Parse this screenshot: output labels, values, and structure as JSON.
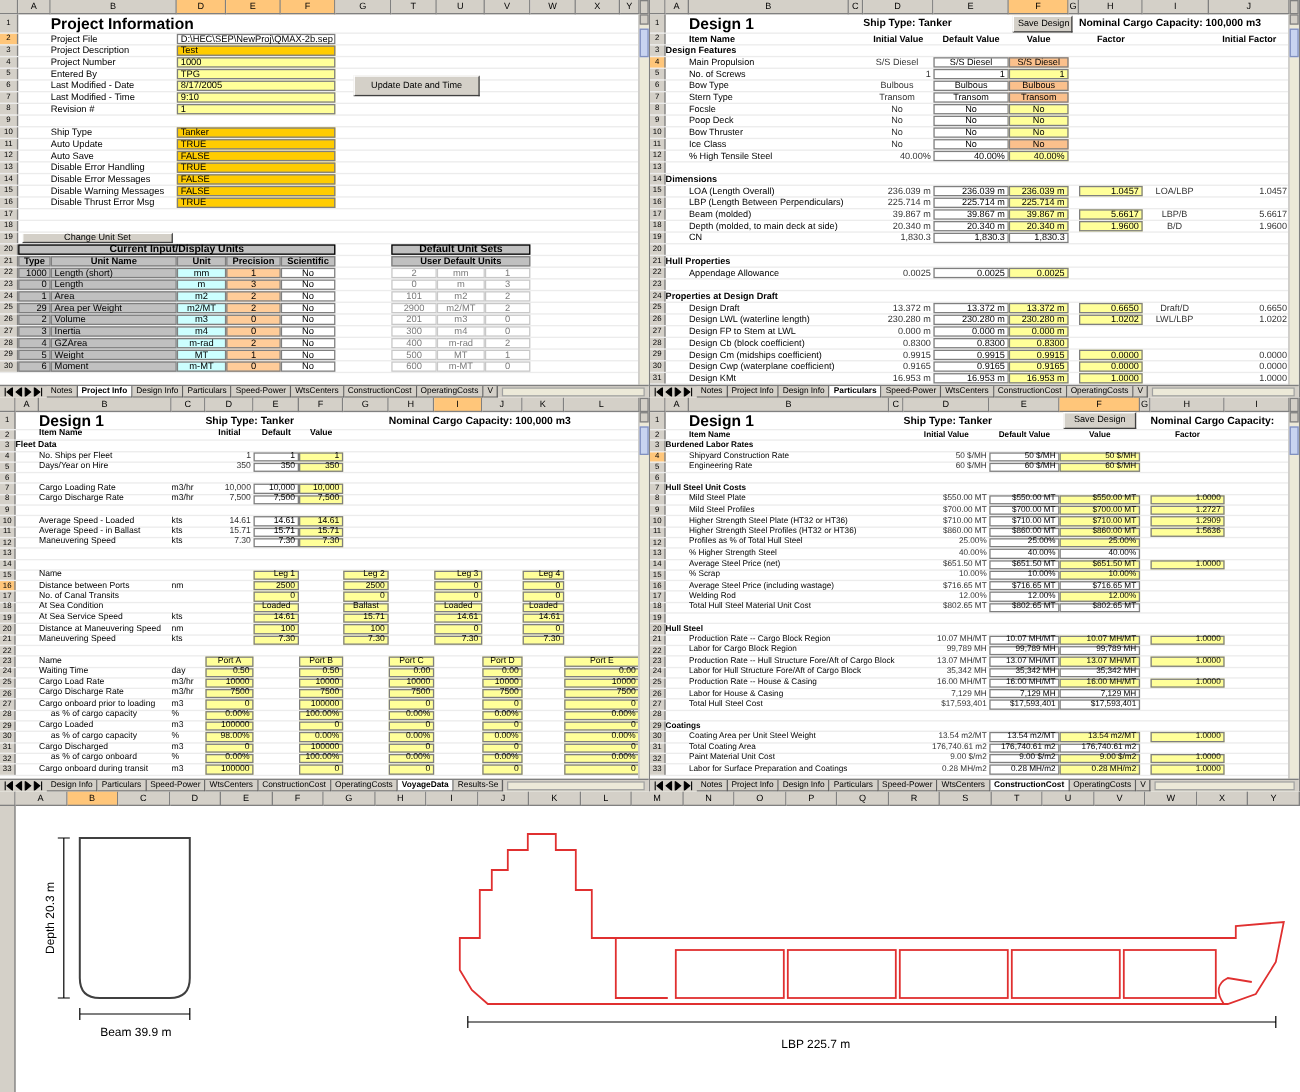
{
  "panes": [
    {
      "kind": "project-info",
      "columns": [
        {
          "label": "A",
          "selected": false
        },
        {
          "label": "B",
          "selected": false
        },
        {
          "label": "D",
          "selected": true
        },
        {
          "label": "E",
          "selected": true
        },
        {
          "label": "F",
          "selected": true
        },
        {
          "label": "G",
          "selected": false
        },
        {
          "label": "T",
          "selected": false
        },
        {
          "label": "U",
          "selected": false
        },
        {
          "label": "V",
          "selected": false
        },
        {
          "label": "W",
          "selected": false
        },
        {
          "label": "X",
          "selected": false
        },
        {
          "label": "Y",
          "selected": false
        }
      ],
      "rows": [
        {
          "number": "1",
          "selected": false,
          "kind": "title",
          "text": "Project Information"
        },
        {
          "number": "2",
          "selected": true,
          "kind": "path-field",
          "label": "Project File",
          "value": "D:\\HEC\\SEP\\NewProj\\QMAX-2b.sep"
        },
        {
          "number": "3",
          "selected": false,
          "kind": "choice-field",
          "label": "Project Description",
          "value": "Test"
        },
        {
          "number": "4",
          "selected": false,
          "kind": "entry-field",
          "label": "Project Number",
          "value": "1000"
        },
        {
          "number": "5",
          "selected": false,
          "kind": "entry-field",
          "label": "Entered By",
          "value": "TPG"
        },
        {
          "number": "6",
          "selected": false,
          "kind": "entry-field",
          "label": "Last Modified - Date",
          "value": "8/17/2005",
          "button": "Update Date and Time"
        },
        {
          "number": "7",
          "selected": false,
          "kind": "entry-field",
          "label": "Last Modified - Time",
          "value": "9:10"
        },
        {
          "number": "8",
          "selected": false,
          "kind": "entry-field",
          "label": "Revision #",
          "value": "1"
        },
        {
          "number": "9",
          "selected": false,
          "kind": "blank"
        },
        {
          "number": "10",
          "selected": false,
          "kind": "choice-field",
          "label": "Ship Type",
          "value": "Tanker"
        },
        {
          "number": "11",
          "selected": false,
          "kind": "choice-field",
          "label": "Auto Update",
          "value": "TRUE"
        },
        {
          "number": "12",
          "selected": false,
          "kind": "choice-field",
          "label": "Auto Save",
          "value": "FALSE"
        },
        {
          "number": "13",
          "selected": false,
          "kind": "choice-field",
          "label": "Disable Error Handling",
          "value": "TRUE"
        },
        {
          "number": "14",
          "selected": false,
          "kind": "choice-field",
          "label": "Disable Error Messages",
          "value": "FALSE"
        },
        {
          "number": "15",
          "selected": false,
          "kind": "choice-field",
          "label": "Disable Warning Messages",
          "value": "FALSE"
        },
        {
          "number": "16",
          "selected": false,
          "kind": "choice-field",
          "label": "Disable Thrust Error Msg",
          "value": "TRUE"
        },
        {
          "number": "17",
          "selected": false,
          "kind": "blank"
        },
        {
          "number": "18",
          "selected": false,
          "kind": "blank"
        },
        {
          "number": "19",
          "selected": false,
          "kind": "button",
          "text": "Change Unit Set"
        },
        {
          "number": "20",
          "selected": false,
          "kind": "table-titles",
          "left": "Current Input/Display Units",
          "right": "Default Unit Sets"
        },
        {
          "number": "21",
          "selected": false,
          "kind": "table-header",
          "headers": [
            "Type",
            "Unit Name",
            "Unit",
            "Precision",
            "Scientific"
          ],
          "right": "User Default Units"
        },
        {
          "number": "22",
          "selected": false,
          "kind": "unit",
          "type": "1000",
          "name": "Length (short)",
          "unit": "mm",
          "precision": "1",
          "scientific": "No",
          "defaults": [
            "2",
            "mm",
            "1"
          ]
        },
        {
          "number": "23",
          "selected": false,
          "kind": "unit",
          "type": "0",
          "name": "Length",
          "unit": "m",
          "precision": "3",
          "scientific": "No",
          "defaults": [
            "0",
            "m",
            "3"
          ]
        },
        {
          "number": "24",
          "selected": false,
          "kind": "unit",
          "type": "1",
          "name": "Area",
          "unit": "m2",
          "precision": "2",
          "scientific": "No",
          "defaults": [
            "101",
            "m2",
            "2"
          ]
        },
        {
          "number": "25",
          "selected": false,
          "kind": "unit",
          "type": "29",
          "name": "Area per Weight",
          "unit": "m2/MT",
          "precision": "2",
          "scientific": "No",
          "defaults": [
            "2900",
            "m2/MT",
            "2"
          ]
        },
        {
          "number": "26",
          "selected": false,
          "kind": "unit",
          "type": "2",
          "name": "Volume",
          "unit": "m3",
          "precision": "0",
          "scientific": "No",
          "defaults": [
            "201",
            "m3",
            "0"
          ]
        },
        {
          "number": "27",
          "selected": false,
          "kind": "unit",
          "type": "3",
          "name": "Inertia",
          "unit": "m4",
          "precision": "0",
          "scientific": "No",
          "defaults": [
            "300",
            "m4",
            "0"
          ]
        },
        {
          "number": "28",
          "selected": false,
          "kind": "unit",
          "type": "4",
          "name": "GZArea",
          "unit": "m-rad",
          "precision": "2",
          "scientific": "No",
          "defaults": [
            "400",
            "m-rad",
            "2"
          ]
        },
        {
          "number": "29",
          "selected": false,
          "kind": "unit",
          "type": "5",
          "name": "Weight",
          "unit": "MT",
          "precision": "1",
          "scientific": "No",
          "defaults": [
            "500",
            "MT",
            "1"
          ]
        },
        {
          "number": "30",
          "selected": false,
          "kind": "unit",
          "type": "6",
          "name": "Moment",
          "unit": "m-MT",
          "precision": "0",
          "scientific": "No",
          "defaults": [
            "600",
            "m-MT",
            "0"
          ]
        }
      ],
      "tabs": [
        {
          "label": "Notes",
          "selected": false
        },
        {
          "label": "Project Info",
          "selected": true
        },
        {
          "label": "Design Info",
          "selected": false
        },
        {
          "label": "Particulars",
          "selected": false
        },
        {
          "label": "Speed-Power",
          "selected": false
        },
        {
          "label": "WtsCenters",
          "selected": false
        },
        {
          "label": "ConstructionCost",
          "selected": false
        },
        {
          "label": "OperatingCosts",
          "selected": false
        },
        {
          "label": "V",
          "selected": false
        }
      ]
    },
    {
      "kind": "design-sheet",
      "columns": [
        {
          "label": "A",
          "selected": false
        },
        {
          "label": "B",
          "selected": false
        },
        {
          "label": "C",
          "selected": false
        },
        {
          "label": "D",
          "selected": false
        },
        {
          "label": "E",
          "selected": false
        },
        {
          "label": "F",
          "selected": true
        },
        {
          "label": "G",
          "selected": false
        },
        {
          "label": "H",
          "selected": false
        },
        {
          "label": "I",
          "selected": false
        },
        {
          "label": "J",
          "selected": false
        }
      ],
      "rows": [
        {
          "number": "1",
          "selected": false,
          "kind": "header",
          "title": "Design 1",
          "ship_type": "Ship Type: Tanker",
          "button": "Save Design",
          "capacity": "Nominal Cargo Capacity: 100,000 m3"
        },
        {
          "number": "2",
          "selected": false,
          "kind": "column-titles",
          "item": "Item Name",
          "initial": "Initial Value",
          "default": "Default Value",
          "value": "Value",
          "factor": "Factor",
          "initial_factor": "Initial Factor"
        },
        {
          "number": "3",
          "selected": false,
          "kind": "section",
          "text": "Design Features"
        },
        {
          "number": "4",
          "selected": true,
          "kind": "option-item",
          "label": "Main Propulsion",
          "initial": "S/S Diesel",
          "default": "S/S Diesel",
          "value": "S/S Diesel"
        },
        {
          "number": "5",
          "selected": false,
          "kind": "input-item",
          "label": "No. of Screws",
          "initial": "1",
          "default": "1",
          "value": "1"
        },
        {
          "number": "6",
          "selected": false,
          "kind": "option-item",
          "label": "Bow Type",
          "initial": "Bulbous",
          "default": "Bulbous",
          "value": "Bulbous"
        },
        {
          "number": "7",
          "selected": false,
          "kind": "option-item",
          "label": "Stern Type",
          "initial": "Transom",
          "default": "Transom",
          "value": "Transom"
        },
        {
          "number": "8",
          "selected": false,
          "kind": "input-item",
          "label": "Focsle",
          "initial": "No",
          "default": "No",
          "value": "No"
        },
        {
          "number": "9",
          "selected": false,
          "kind": "input-item",
          "label": "Poop Deck",
          "initial": "No",
          "default": "No",
          "value": "No"
        },
        {
          "number": "10",
          "selected": false,
          "kind": "input-item",
          "label": "Bow Thruster",
          "initial": "No",
          "default": "No",
          "value": "No"
        },
        {
          "number": "11",
          "selected": false,
          "kind": "option-item",
          "label": "Ice Class",
          "initial": "No",
          "default": "No",
          "value": "No"
        },
        {
          "number": "12",
          "selected": false,
          "kind": "input-item",
          "label": "% High Tensile Steel",
          "initial": "40.00%",
          "default": "40.00%",
          "value": "40.00%"
        },
        {
          "number": "13",
          "selected": false,
          "kind": "blank"
        },
        {
          "number": "14",
          "selected": false,
          "kind": "section",
          "text": "Dimensions"
        },
        {
          "number": "15",
          "selected": false,
          "kind": "input-item",
          "label": "LOA (Length Overall)",
          "initial": "236.039 m",
          "default": "236.039 m",
          "value": "236.039 m",
          "factor": "1.0457",
          "ratio": "LOA/LBP",
          "initial_factor": "1.0457"
        },
        {
          "number": "16",
          "selected": false,
          "kind": "input-item",
          "label": "LBP (Length Between Perpendiculars)",
          "initial": "225.714 m",
          "default": "225.714 m",
          "value": "225.714 m"
        },
        {
          "number": "17",
          "selected": false,
          "kind": "input-item",
          "label": "Beam (molded)",
          "initial": "39.867 m",
          "default": "39.867 m",
          "value": "39.867 m",
          "factor": "5.6617",
          "ratio": "LBP/B",
          "initial_factor": "5.6617"
        },
        {
          "number": "18",
          "selected": false,
          "kind": "input-item",
          "label": "Depth (molded, to main deck at side)",
          "initial": "20.340 m",
          "default": "20.340 m",
          "value": "20.340 m",
          "factor": "1.9600",
          "ratio": "B/D",
          "initial_factor": "1.9600"
        },
        {
          "number": "19",
          "selected": false,
          "kind": "computed-item",
          "label": "CN",
          "initial": "1,830.3",
          "default": "1,830.3",
          "value": "1,830.3"
        },
        {
          "number": "20",
          "selected": false,
          "kind": "blank"
        },
        {
          "number": "21",
          "selected": false,
          "kind": "section",
          "text": "Hull Properties"
        },
        {
          "number": "22",
          "selected": false,
          "kind": "input-item",
          "label": "Appendage Allowance",
          "initial": "0.0025",
          "default": "0.0025",
          "value": "0.0025"
        },
        {
          "number": "23",
          "selected": false,
          "kind": "blank"
        },
        {
          "number": "24",
          "selected": false,
          "kind": "section",
          "text": "Properties at Design Draft"
        },
        {
          "number": "25",
          "selected": false,
          "kind": "input-item",
          "label": "Design Draft",
          "initial": "13.372 m",
          "default": "13.372 m",
          "value": "13.372 m",
          "factor": "0.6650",
          "ratio": "Draft/D",
          "initial_factor": "0.6650"
        },
        {
          "number": "26",
          "selected": false,
          "kind": "input-item",
          "label": "Design LWL (waterline length)",
          "initial": "230.280 m",
          "default": "230.280 m",
          "value": "230.280 m",
          "factor": "1.0202",
          "ratio": "LWL/LBP",
          "initial_factor": "1.0202"
        },
        {
          "number": "27",
          "selected": false,
          "kind": "input-item",
          "label": "Design FP to Stem at LWL",
          "initial": "0.000 m",
          "default": "0.000 m",
          "value": "0.000 m"
        },
        {
          "number": "28",
          "selected": false,
          "kind": "input-item",
          "label": "Design Cb (block coefficient)",
          "initial": "0.8300",
          "default": "0.8300",
          "value": "0.8300"
        },
        {
          "number": "29",
          "selected": false,
          "kind": "input-item",
          "label": "Design Cm (midships coefficient)",
          "initial": "0.9915",
          "default": "0.9915",
          "value": "0.9915",
          "factor": "0.0000",
          "initial_factor": "0.0000"
        },
        {
          "number": "30",
          "selected": false,
          "kind": "input-item",
          "label": "Design Cwp (waterplane coefficient)",
          "initial": "0.9165",
          "default": "0.9165",
          "value": "0.9165",
          "factor": "0.0000",
          "initial_factor": "0.0000"
        },
        {
          "number": "31",
          "selected": false,
          "kind": "input-item",
          "label": "Design KMt",
          "initial": "16.953 m",
          "default": "16.953 m",
          "value": "16.953 m",
          "factor": "1.0000",
          "initial_factor": "1.0000"
        }
      ],
      "tabs": [
        {
          "label": "Notes",
          "selected": false
        },
        {
          "label": "Project Info",
          "selected": false
        },
        {
          "label": "Design Info",
          "selected": false
        },
        {
          "label": "Particulars",
          "selected": true
        },
        {
          "label": "Speed-Power",
          "selected": false
        },
        {
          "label": "WtsCenters",
          "selected": false
        },
        {
          "label": "ConstructionCost",
          "selected": false
        },
        {
          "label": "OperatingCosts",
          "selected": false
        },
        {
          "label": "V",
          "selected": false
        }
      ]
    },
    {
      "kind": "voyage-sheet",
      "columns": [
        {
          "label": "A",
          "selected": false
        },
        {
          "label": "B",
          "selected": false
        },
        {
          "label": "C",
          "selected": false
        },
        {
          "label": "D",
          "selected": false
        },
        {
          "label": "E",
          "selected": false
        },
        {
          "label": "F",
          "selected": false
        },
        {
          "label": "G",
          "selected": false
        },
        {
          "label": "H",
          "selected": false
        },
        {
          "label": "I",
          "selected": true
        },
        {
          "label": "J",
          "selected": false
        },
        {
          "label": "K",
          "selected": false
        },
        {
          "label": "L",
          "selected": false
        }
      ],
      "rows": [
        {
          "number": "1",
          "selected": false,
          "kind": "header",
          "title": "Design 1",
          "ship_type": "Ship Type: Tanker",
          "capacity": "Nominal Cargo Capacity: 100,000 m3"
        },
        {
          "number": "2",
          "selected": false,
          "kind": "column-titles",
          "item": "Item Name",
          "initial": "Initial",
          "default": "Default",
          "value": "Value"
        },
        {
          "number": "3",
          "selected": false,
          "kind": "section",
          "text": "Fleet Data"
        },
        {
          "number": "4",
          "selected": false,
          "kind": "input-item",
          "label": "No. Ships per Fleet",
          "initial": "1",
          "default": "1",
          "value": "1"
        },
        {
          "number": "5",
          "selected": false,
          "kind": "input-item",
          "label": "Days/Year on Hire",
          "initial": "350",
          "default": "350",
          "value": "350"
        },
        {
          "number": "6",
          "selected": false,
          "kind": "blank"
        },
        {
          "number": "7",
          "selected": false,
          "kind": "input-item",
          "label": "Cargo Loading Rate",
          "unit": "m3/hr",
          "initial": "10,000",
          "default": "10,000",
          "value": "10,000"
        },
        {
          "number": "8",
          "selected": false,
          "kind": "input-item",
          "label": "Cargo Discharge Rate",
          "unit": "m3/hr",
          "initial": "7,500",
          "default": "7,500",
          "value": "7,500"
        },
        {
          "number": "9",
          "selected": false,
          "kind": "blank"
        },
        {
          "number": "10",
          "selected": false,
          "kind": "input-item",
          "label": "Average Speed - Loaded",
          "unit": "kts",
          "initial": "14.61",
          "default": "14.61",
          "value": "14.61"
        },
        {
          "number": "11",
          "selected": false,
          "kind": "input-item",
          "label": "Average Speed - in Ballast",
          "unit": "kts",
          "initial": "15.71",
          "default": "15.71",
          "value": "15.71"
        },
        {
          "number": "12",
          "selected": false,
          "kind": "input-item",
          "label": "Maneuvering Speed",
          "unit": "kts",
          "initial": "7.30",
          "default": "7.30",
          "value": "7.30"
        },
        {
          "number": "13",
          "selected": false,
          "kind": "blank"
        },
        {
          "number": "14",
          "selected": false,
          "kind": "blank"
        },
        {
          "number": "15",
          "selected": false,
          "kind": "legs",
          "label": "Name",
          "values": [
            "Leg 1",
            "Leg 2",
            "Leg 3",
            "Leg 4"
          ]
        },
        {
          "number": "16",
          "selected": true,
          "kind": "legs",
          "label": "Distance between Ports",
          "unit": "nm",
          "values": [
            "2500",
            "2500",
            "0",
            "0"
          ]
        },
        {
          "number": "17",
          "selected": false,
          "kind": "legs",
          "label": "No. of Canal Transits",
          "values": [
            "0",
            "0",
            "0",
            "0"
          ]
        },
        {
          "number": "18",
          "selected": false,
          "kind": "legs",
          "label": "At Sea Condition",
          "values": [
            "Loaded",
            "Ballast",
            "Loaded",
            "Loaded"
          ]
        },
        {
          "number": "19",
          "selected": false,
          "kind": "legs",
          "label": "At Sea Service Speed",
          "unit": "kts",
          "values": [
            "14.61",
            "15.71",
            "14.61",
            "14.61"
          ]
        },
        {
          "number": "20",
          "selected": false,
          "kind": "legs",
          "label": "Distance at Maneuvering Speed",
          "unit": "nm",
          "values": [
            "100",
            "100",
            "0",
            "0"
          ]
        },
        {
          "number": "21",
          "selected": false,
          "kind": "legs",
          "label": "Maneuvering Speed",
          "unit": "kts",
          "values": [
            "7.30",
            "7.30",
            "7.30",
            "7.30"
          ]
        },
        {
          "number": "22",
          "selected": false,
          "kind": "blank"
        },
        {
          "number": "23",
          "selected": false,
          "kind": "ports",
          "label": "Name",
          "values": [
            "Port A",
            "Port B",
            "Port C",
            "Port D",
            "Port E"
          ]
        },
        {
          "number": "24",
          "selected": false,
          "kind": "ports",
          "label": "Waiting Time",
          "unit": "day",
          "values": [
            "0.50",
            "0.50",
            "0.00",
            "0.00",
            "0.00"
          ]
        },
        {
          "number": "25",
          "selected": false,
          "kind": "ports",
          "label": "Cargo Load Rate",
          "unit": "m3/hr",
          "values": [
            "10000",
            "10000",
            "10000",
            "10000",
            "10000"
          ]
        },
        {
          "number": "26",
          "selected": false,
          "kind": "ports",
          "label": "Cargo Discharge Rate",
          "unit": "m3/hr",
          "values": [
            "7500",
            "7500",
            "7500",
            "7500",
            "7500"
          ]
        },
        {
          "number": "27",
          "selected": false,
          "kind": "ports",
          "label": "Cargo onboard prior to loading",
          "unit": "m3",
          "values": [
            "0",
            "100000",
            "0",
            "0",
            "0"
          ]
        },
        {
          "number": "28",
          "selected": false,
          "kind": "sub-ports",
          "label": "as % of cargo capacity",
          "unit": "%",
          "values": [
            "0.00%",
            "100.00%",
            "0.00%",
            "0.00%",
            "0.00%"
          ]
        },
        {
          "number": "29",
          "selected": false,
          "kind": "ports",
          "label": "Cargo Loaded",
          "unit": "m3",
          "values": [
            "100000",
            "0",
            "0",
            "0",
            "0"
          ]
        },
        {
          "number": "30",
          "selected": false,
          "kind": "sub-ports",
          "label": "as % of cargo capacity",
          "unit": "%",
          "values": [
            "98.00%",
            "0.00%",
            "0.00%",
            "0.00%",
            "0.00%"
          ]
        },
        {
          "number": "31",
          "selected": false,
          "kind": "ports",
          "label": "Cargo Discharged",
          "unit": "m3",
          "values": [
            "0",
            "100000",
            "0",
            "0",
            "0"
          ]
        },
        {
          "number": "32",
          "selected": false,
          "kind": "sub-ports",
          "label": "as % of cargo onboard",
          "unit": "%",
          "values": [
            "0.00%",
            "100.00%",
            "0.00%",
            "0.00%",
            "0.00%"
          ]
        },
        {
          "number": "33",
          "selected": false,
          "kind": "ports",
          "label": "Cargo onboard during transit",
          "unit": "m3",
          "values": [
            "100000",
            "0",
            "0",
            "0",
            "0"
          ]
        }
      ],
      "tabs": [
        {
          "label": "Design Info",
          "selected": false
        },
        {
          "label": "Particulars",
          "selected": false
        },
        {
          "label": "Speed-Power",
          "selected": false
        },
        {
          "label": "WtsCenters",
          "selected": false
        },
        {
          "label": "ConstructionCost",
          "selected": false
        },
        {
          "label": "OperatingCosts",
          "selected": false
        },
        {
          "label": "VoyageData",
          "selected": true
        },
        {
          "label": "Results-Se",
          "selected": false
        }
      ]
    },
    {
      "kind": "design-sheet",
      "columns": [
        {
          "label": "A",
          "selected": false
        },
        {
          "label": "B",
          "selected": false
        },
        {
          "label": "C",
          "selected": false
        },
        {
          "label": "D",
          "selected": false
        },
        {
          "label": "E",
          "selected": false
        },
        {
          "label": "F",
          "selected": true
        },
        {
          "label": "G",
          "selected": false
        },
        {
          "label": "H",
          "selected": false
        },
        {
          "label": "I",
          "selected": false
        }
      ],
      "rows": [
        {
          "number": "1",
          "selected": false,
          "kind": "header",
          "title": "Design 1",
          "ship_type": "Ship Type: Tanker",
          "button": "Save Design",
          "capacity": "Nominal Cargo Capacity:"
        },
        {
          "number": "2",
          "selected": false,
          "kind": "column-titles",
          "item": "Item Name",
          "initial": "Initial Value",
          "default": "Default Value",
          "value": "Value",
          "factor": "Factor"
        },
        {
          "number": "3",
          "selected": false,
          "kind": "section",
          "text": "Burdened Labor Rates"
        },
        {
          "number": "4",
          "selected": true,
          "kind": "input-item",
          "label": "Shipyard Construction Rate",
          "initial": "50 $/MH",
          "default": "50 $/MH",
          "value": "50 $/MH"
        },
        {
          "number": "5",
          "selected": false,
          "kind": "input-item",
          "label": "Engineering Rate",
          "initial": "60 $/MH",
          "default": "60 $/MH",
          "value": "60 $/MH"
        },
        {
          "number": "6",
          "selected": false,
          "kind": "blank"
        },
        {
          "number": "7",
          "selected": false,
          "kind": "section",
          "text": "Hull Steel Unit Costs"
        },
        {
          "number": "8",
          "selected": false,
          "kind": "input-item",
          "label": "Mild Steel Plate",
          "initial": "$550.00 MT",
          "default": "$550.00 MT",
          "value": "$550.00 MT",
          "factor": "1.0000"
        },
        {
          "number": "9",
          "selected": false,
          "kind": "input-item",
          "label": "Mild Steel Profiles",
          "initial": "$700.00 MT",
          "default": "$700.00 MT",
          "value": "$700.00 MT",
          "factor": "1.2727"
        },
        {
          "number": "10",
          "selected": false,
          "kind": "input-item",
          "label": "Higher Strength Steel Plate (HT32 or HT36)",
          "initial": "$710.00 MT",
          "default": "$710.00 MT",
          "value": "$710.00 MT",
          "factor": "1.2909"
        },
        {
          "number": "11",
          "selected": false,
          "kind": "input-item",
          "label": "Higher Strength Steel Profiles (HT32 or HT36)",
          "initial": "$860.00 MT",
          "default": "$860.00 MT",
          "value": "$860.00 MT",
          "factor": "1.5636"
        },
        {
          "number": "12",
          "selected": false,
          "kind": "input-item",
          "label": "Profiles as % of Total Hull Steel",
          "initial": "25.00%",
          "default": "25.00%",
          "value": "25.00%"
        },
        {
          "number": "13",
          "selected": false,
          "kind": "computed-item",
          "label": "% Higher Strength Steel",
          "initial": "40.00%",
          "default": "40.00%",
          "value": "40.00%"
        },
        {
          "number": "14",
          "selected": false,
          "kind": "input-item",
          "label": "Average Steel Price (net)",
          "initial": "$651.50 MT",
          "default": "$651.50 MT",
          "value": "$651.50 MT",
          "factor": "1.0000"
        },
        {
          "number": "15",
          "selected": false,
          "kind": "input-item",
          "label": "% Scrap",
          "initial": "10.00%",
          "default": "10.00%",
          "value": "10.00%"
        },
        {
          "number": "16",
          "selected": false,
          "kind": "computed-item",
          "label": "Average Steel Price (including wastage)",
          "initial": "$716.65 MT",
          "default": "$716.65 MT",
          "value": "$716.65 MT"
        },
        {
          "number": "17",
          "selected": false,
          "kind": "input-item",
          "label": "Welding Rod",
          "initial": "12.00%",
          "default": "12.00%",
          "value": "12.00%"
        },
        {
          "number": "18",
          "selected": false,
          "kind": "computed-item",
          "label": "Total Hull Steel Material Unit Cost",
          "initial": "$802.65 MT",
          "default": "$802.65 MT",
          "value": "$802.65 MT"
        },
        {
          "number": "19",
          "selected": false,
          "kind": "blank"
        },
        {
          "number": "20",
          "selected": false,
          "kind": "section",
          "text": "Hull Steel"
        },
        {
          "number": "21",
          "selected": false,
          "kind": "input-item",
          "label": "Production Rate -- Cargo Block Region",
          "initial": "10.07 MH/MT",
          "default": "10.07 MH/MT",
          "value": "10.07 MH/MT",
          "factor": "1.0000"
        },
        {
          "number": "22",
          "selected": false,
          "kind": "computed-item",
          "label": "Labor for Cargo Block Region",
          "initial": "99,789 MH",
          "default": "99,789 MH",
          "value": "99,789 MH"
        },
        {
          "number": "23",
          "selected": false,
          "kind": "input-item",
          "label": "Production Rate -- Hull Structure Fore/Aft of Cargo Block",
          "initial": "13.07 MH/MT",
          "default": "13.07 MH/MT",
          "value": "13.07 MH/MT",
          "factor": "1.0000"
        },
        {
          "number": "24",
          "selected": false,
          "kind": "computed-item",
          "label": "Labor for Hull Structure Fore/Aft of Cargo Block",
          "initial": "35,342 MH",
          "default": "35,342 MH",
          "value": "35,342 MH"
        },
        {
          "number": "25",
          "selected": false,
          "kind": "input-item",
          "label": "Production Rate -- House & Casing",
          "initial": "16.00 MH/MT",
          "default": "16.00 MH/MT",
          "value": "16.00 MH/MT",
          "factor": "1.0000"
        },
        {
          "number": "26",
          "selected": false,
          "kind": "computed-item",
          "label": "Labor for House & Casing",
          "initial": "7,129 MH",
          "default": "7,129 MH",
          "value": "7,129 MH"
        },
        {
          "number": "27",
          "selected": false,
          "kind": "computed-item",
          "label": "Total Hull Steel Cost",
          "initial": "$17,593,401",
          "default": "$17,593,401",
          "value": "$17,593,401"
        },
        {
          "number": "28",
          "selected": false,
          "kind": "blank"
        },
        {
          "number": "29",
          "selected": false,
          "kind": "section",
          "text": "Coatings"
        },
        {
          "number": "30",
          "selected": false,
          "kind": "input-item",
          "label": "Coating Area per Unit Steel Weight",
          "initial": "13.54 m2/MT",
          "default": "13.54 m2/MT",
          "value": "13.54 m2/MT",
          "factor": "1.0000"
        },
        {
          "number": "31",
          "selected": false,
          "kind": "computed-item",
          "label": "Total Coating Area",
          "initial": "176,740.61 m2",
          "default": "176,740.61 m2",
          "value": "176,740.61 m2"
        },
        {
          "number": "32",
          "selected": false,
          "kind": "input-item",
          "label": "Paint Material Unit Cost",
          "initial": "9.00 $/m2",
          "default": "9.00 $/m2",
          "value": "9.00 $/m2",
          "factor": "1.0000"
        },
        {
          "number": "33",
          "selected": false,
          "kind": "input-item",
          "label": "Labor for Surface Preparation and Coatings",
          "initial": "0.28 MH/m2",
          "default": "0.28 MH/m2",
          "value": "0.28 MH/m2",
          "factor": "1.0000"
        }
      ],
      "tabs": [
        {
          "label": "Notes",
          "selected": false
        },
        {
          "label": "Project Info",
          "selected": false
        },
        {
          "label": "Design Info",
          "selected": false
        },
        {
          "label": "Particulars",
          "selected": false
        },
        {
          "label": "Speed-Power",
          "selected": false
        },
        {
          "label": "WtsCenters",
          "selected": false
        },
        {
          "label": "ConstructionCost",
          "selected": true
        },
        {
          "label": "OperatingCosts",
          "selected": false
        },
        {
          "label": "V",
          "selected": false
        }
      ]
    }
  ],
  "drawing_pane": {
    "columns": [
      {
        "label": "A",
        "selected": false
      },
      {
        "label": "B",
        "selected": true
      },
      {
        "label": "C",
        "selected": false
      },
      {
        "label": "D",
        "selected": false
      },
      {
        "label": "E",
        "selected": false
      },
      {
        "label": "F",
        "selected": false
      },
      {
        "label": "G",
        "selected": false
      },
      {
        "label": "H",
        "selected": false
      },
      {
        "label": "I",
        "selected": false
      },
      {
        "label": "J",
        "selected": false
      },
      {
        "label": "K",
        "selected": false
      },
      {
        "label": "L",
        "selected": false
      },
      {
        "label": "M",
        "selected": false
      },
      {
        "label": "N",
        "selected": false
      },
      {
        "label": "O",
        "selected": false
      },
      {
        "label": "P",
        "selected": false
      },
      {
        "label": "Q",
        "selected": false
      },
      {
        "label": "R",
        "selected": false
      },
      {
        "label": "S",
        "selected": false
      },
      {
        "label": "T",
        "selected": false
      },
      {
        "label": "U",
        "selected": false
      },
      {
        "label": "V",
        "selected": false
      },
      {
        "label": "W",
        "selected": false
      },
      {
        "label": "X",
        "selected": false
      },
      {
        "label": "Y",
        "selected": false
      }
    ],
    "depth_label": "Depth 20.3 m",
    "beam_label": "Beam 39.9 m",
    "length_label": "LBP 225.7 m"
  }
}
